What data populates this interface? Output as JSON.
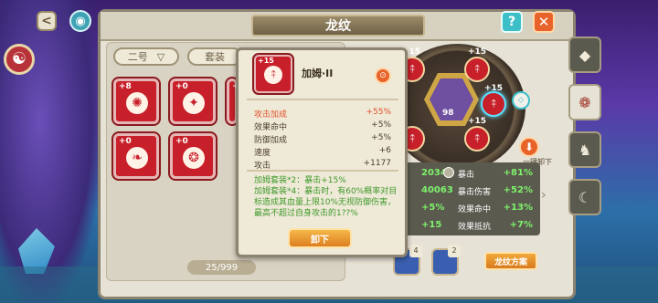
{
  "window": {
    "title": "龙纹"
  },
  "header": {
    "back_glyph": "<",
    "eye_glyph": "◉",
    "help_glyph": "?",
    "close_glyph": "✕"
  },
  "filters": {
    "dropdown_label": "二号",
    "dropdown_arrow": "▽",
    "set_label": "套装"
  },
  "inventory": {
    "slots": [
      {
        "level": "+8",
        "glyph": "✺"
      },
      {
        "level": "+0",
        "glyph": "✦"
      },
      {
        "level": "+0",
        "glyph": "✺"
      },
      {
        "level": "+0",
        "glyph": "❧"
      },
      {
        "level": "+0",
        "glyph": "❂"
      }
    ],
    "counter": "25/999"
  },
  "ring": {
    "nodes": [
      {
        "level": "+15",
        "glyph": "⤉"
      },
      {
        "level": "+15",
        "glyph": "⤉"
      },
      {
        "level": "+15",
        "glyph": "⤉"
      },
      {
        "level": "+15",
        "glyph": "⤉"
      },
      {
        "level": "+15",
        "glyph": "⤉"
      },
      {
        "level": "+15",
        "glyph": "⤉"
      }
    ],
    "center_level": "98",
    "unequip_all_label": "一键卸下"
  },
  "stats": [
    {
      "left": "20344",
      "name": "暴击",
      "right": "+81%"
    },
    {
      "left": "40063",
      "name": "暴击伤害",
      "right": "+52%"
    },
    {
      "left": "+5%",
      "name": "效果命中",
      "right": "+13%"
    },
    {
      "left": "+15",
      "name": "效果抵抗",
      "right": "+7%"
    }
  ],
  "bottom": {
    "item_a_count": "4",
    "item_b_count": "2",
    "plan_label": "龙纹方案"
  },
  "side_tabs": [
    "◆",
    "❁",
    "♞",
    "☾"
  ],
  "tooltip": {
    "level": "+15",
    "name": "加姆·II",
    "lock_glyph": "🔒",
    "attributes": [
      {
        "name": "攻击加成",
        "value": "+55%",
        "main": true
      },
      {
        "name": "效果命中",
        "value": "+5%"
      },
      {
        "name": "防御加成",
        "value": "+5%"
      },
      {
        "name": "速度",
        "value": "+6"
      },
      {
        "name": "攻击",
        "value": "+1177"
      }
    ],
    "set_line_1": "加姆套装*2：暴击+15%",
    "set_line_2": "加姆套装*4：暴击时，有60%概率对目标造成其血量上限10%无视防御伤害，最高不超过自身攻击的1",
    "set_line_2_tail": "??%",
    "unequip_label": "卸下"
  },
  "colors": {
    "accent": "#e8632a",
    "red_rune": "#c8202a",
    "green_text": "#3f9a2a"
  }
}
